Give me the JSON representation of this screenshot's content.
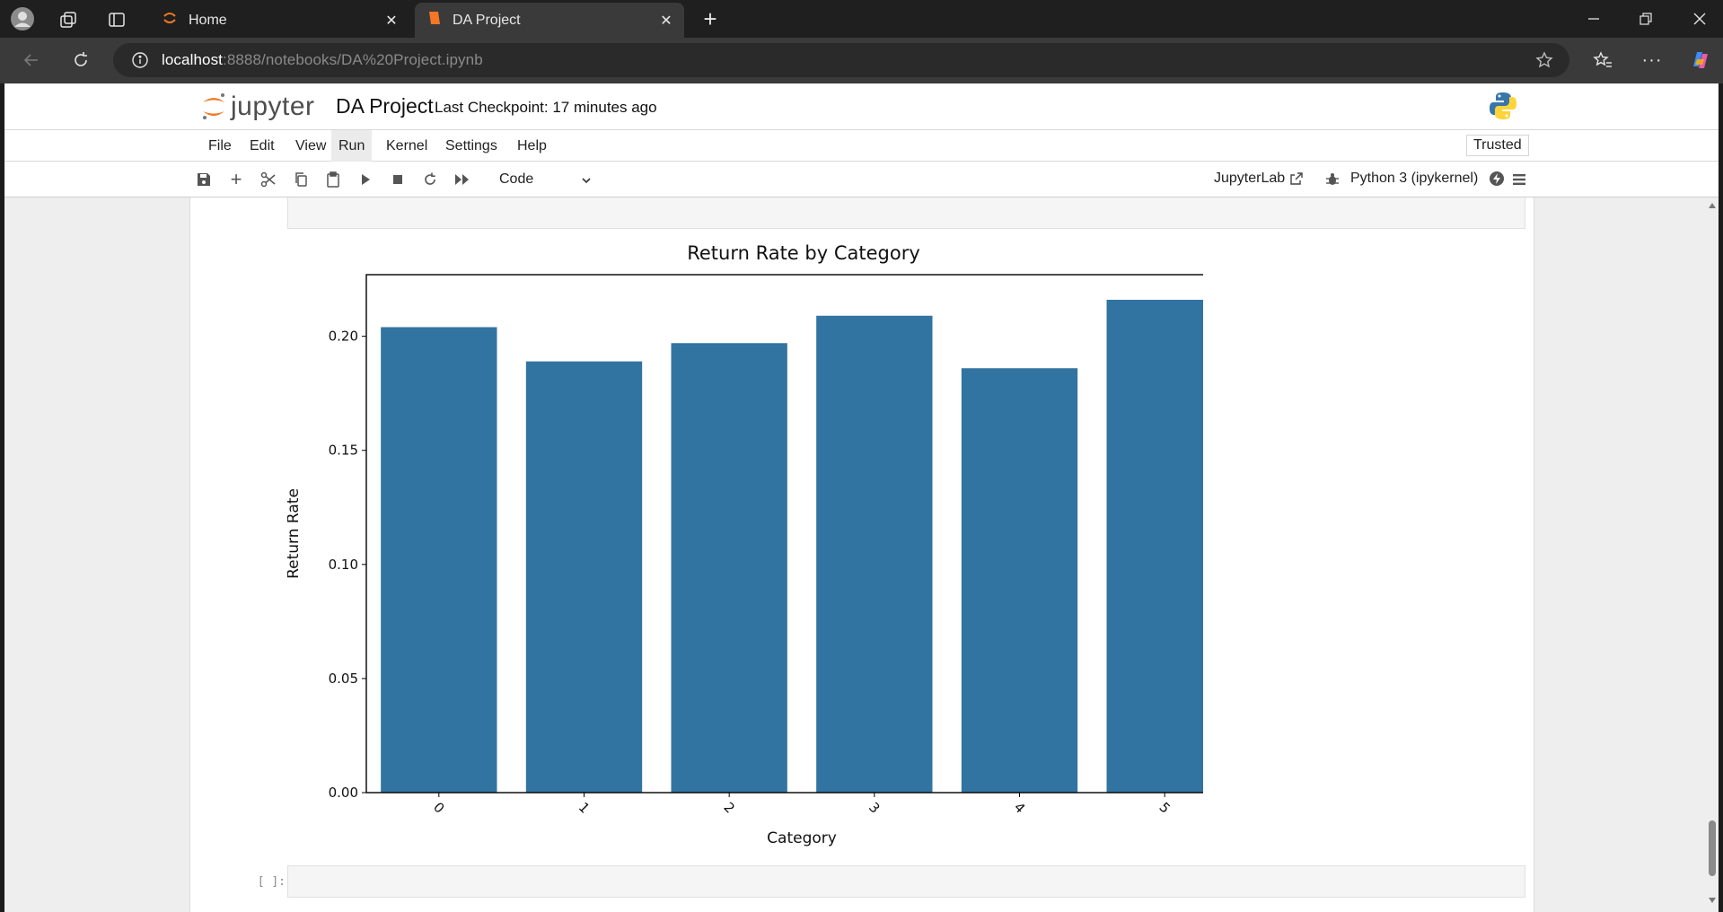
{
  "browser": {
    "tabs": [
      {
        "title": "Home",
        "active": false
      },
      {
        "title": "DA Project",
        "active": true
      }
    ],
    "url_host": "localhost",
    "url_path": ":8888/notebooks/DA%20Project.ipynb"
  },
  "header": {
    "logo_text": "jupyter",
    "notebook_title": "DA Project",
    "checkpoint": "Last Checkpoint: 17 minutes ago",
    "trusted": "Trusted"
  },
  "menu": [
    "File",
    "Edit",
    "View",
    "Run",
    "Kernel",
    "Settings",
    "Help"
  ],
  "menu_active": "Run",
  "toolbar": {
    "cell_type": "Code",
    "jupyterlab": "JupyterLab",
    "kernel": "Python 3 (ipykernel)"
  },
  "cells": {
    "next_prompt": "[ ]:"
  },
  "colors": {
    "bar": "#3274a1",
    "jupyter_orange": "#f37726"
  },
  "chart_data": {
    "type": "bar",
    "title": "Return Rate by Category",
    "xlabel": "Category",
    "ylabel": "Return Rate",
    "categories": [
      "0",
      "1",
      "2",
      "3",
      "4",
      "5"
    ],
    "values": [
      0.204,
      0.189,
      0.197,
      0.209,
      0.186,
      0.216
    ],
    "ylim": [
      0,
      0.227
    ],
    "yticks": [
      0.0,
      0.05,
      0.1,
      0.15,
      0.2
    ],
    "ytick_labels": [
      "0.00",
      "0.05",
      "0.10",
      "0.15",
      "0.20"
    ],
    "grid": false,
    "xtick_rotation": 45
  }
}
